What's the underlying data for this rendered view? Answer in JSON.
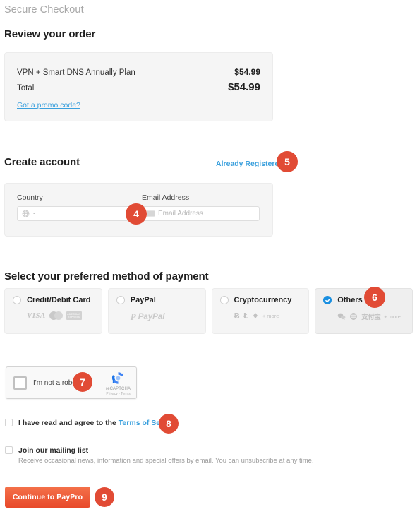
{
  "header": {
    "secure_title": "Secure Checkout"
  },
  "order": {
    "heading": "Review your order",
    "rows": [
      {
        "label": "VPN + Smart DNS Annually Plan",
        "amount": "$54.99"
      },
      {
        "label": "Total",
        "amount": "$54.99"
      }
    ],
    "promo_link": "Got a promo code?"
  },
  "account": {
    "heading": "Create account",
    "already_registered": "Already Registered?",
    "country": {
      "label": "Country",
      "value": "-",
      "icon": "globe-icon"
    },
    "email": {
      "label": "Email Address",
      "placeholder": "Email Address",
      "value": "",
      "icon": "envelope-icon"
    }
  },
  "payment": {
    "heading": "Select your preferred method of payment",
    "methods": [
      {
        "name": "Credit/Debit Card",
        "selected": false,
        "logos": [
          "visa-logo",
          "mastercard-logo",
          "amex-logo"
        ],
        "logo_labels": [
          "VISA",
          "",
          "AMERICAN EXPRESS"
        ],
        "more": ""
      },
      {
        "name": "PayPal",
        "selected": false,
        "logos": [
          "paypal-logo"
        ],
        "logo_labels": [
          "PayPal"
        ],
        "more": ""
      },
      {
        "name": "Cryptocurrency",
        "selected": false,
        "logos": [
          "bitcoin-icon",
          "litecoin-icon",
          "ethereum-icon"
        ],
        "logo_labels": [
          "Ƀ",
          "Ł",
          "♦"
        ],
        "more": "+ more"
      },
      {
        "name": "Others",
        "selected": true,
        "logos": [
          "wechatpay-logo",
          "unionpay-logo",
          "alipay-logo"
        ],
        "logo_labels": [
          "",
          "",
          "支付宝"
        ],
        "more": "+ more"
      }
    ]
  },
  "recaptcha": {
    "label": "I'm not a robot",
    "brand": "reCAPTCHA",
    "terms": "Privacy - Terms",
    "checked": false
  },
  "agreements": {
    "tos": {
      "prefix": "I have read and agree to the ",
      "link": "Terms of Service",
      "checked": false
    },
    "mailing": {
      "label": "Join our mailing list",
      "description": "Receive occasional news, information and special offers by email. You can unsubscribe at any time.",
      "checked": false
    }
  },
  "actions": {
    "continue_label": "Continue to PayPro"
  },
  "badges": {
    "b4": "4",
    "b5": "5",
    "b6": "6",
    "b7": "7",
    "b8": "8",
    "b9": "9"
  },
  "colors": {
    "badge": "#e14b35",
    "link": "#3ba0dd",
    "selected_radio": "#1a8fe0",
    "button_start": "#f4714a",
    "button_end": "#e8492a",
    "panel_bg": "#f5f5f5"
  }
}
